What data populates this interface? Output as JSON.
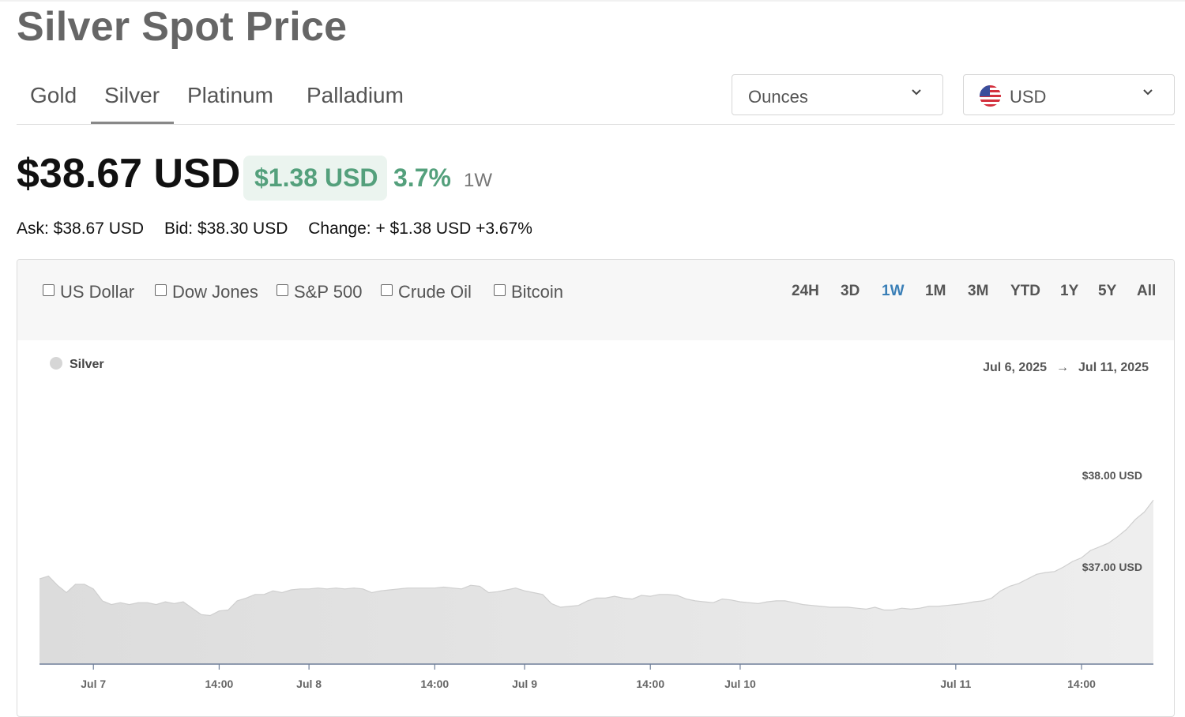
{
  "page_title": "Silver Spot Price",
  "tabs": [
    "Gold",
    "Silver",
    "Platinum",
    "Palladium"
  ],
  "active_tab": "Silver",
  "unit_select": {
    "value": "Ounces",
    "icon": "chevron-down-icon"
  },
  "currency_select": {
    "value": "USD",
    "icon": "us-flag-icon"
  },
  "price": {
    "value": "$38.67 USD",
    "change": "$1.38 USD",
    "change_pct": "3.7%",
    "period": "1W",
    "positive_color": "#54a07c"
  },
  "quotes": {
    "ask": "Ask: $38.67 USD",
    "bid": "Bid: $38.30 USD",
    "change": "Change: + $1.38 USD +3.67%"
  },
  "compare_options": [
    "US Dollar",
    "Dow Jones",
    "S&P 500",
    "Crude Oil",
    "Bitcoin"
  ],
  "ranges": [
    "24H",
    "3D",
    "1W",
    "1M",
    "3M",
    "YTD",
    "1Y",
    "5Y",
    "All"
  ],
  "active_range": "1W",
  "chart_data": {
    "type": "area",
    "date_range": {
      "from": "Jul 6, 2025",
      "arrow": "→",
      "to": "Jul 11, 2025"
    },
    "series": [
      {
        "name": "Silver",
        "color": "#d6d6d6",
        "points": [
          [
            "2025-07-06 18:00",
            36.87
          ],
          [
            "2025-07-06 19:00",
            36.9
          ],
          [
            "2025-07-06 20:00",
            36.8
          ],
          [
            "2025-07-06 21:00",
            36.72
          ],
          [
            "2025-07-06 22:00",
            36.81
          ],
          [
            "2025-07-06 23:00",
            36.81
          ],
          [
            "2025-07-07 00:00",
            36.76
          ],
          [
            "2025-07-07 01:00",
            36.63
          ],
          [
            "2025-07-07 02:00",
            36.59
          ],
          [
            "2025-07-07 03:00",
            36.61
          ],
          [
            "2025-07-07 04:00",
            36.59
          ],
          [
            "2025-07-07 05:00",
            36.61
          ],
          [
            "2025-07-07 06:00",
            36.61
          ],
          [
            "2025-07-07 07:00",
            36.59
          ],
          [
            "2025-07-07 08:00",
            36.62
          ],
          [
            "2025-07-07 09:00",
            36.6
          ],
          [
            "2025-07-07 10:00",
            36.62
          ],
          [
            "2025-07-07 11:00",
            36.55
          ],
          [
            "2025-07-07 12:00",
            36.48
          ],
          [
            "2025-07-07 13:00",
            36.47
          ],
          [
            "2025-07-07 14:00",
            36.52
          ],
          [
            "2025-07-07 15:00",
            36.53
          ],
          [
            "2025-07-07 16:00",
            36.63
          ],
          [
            "2025-07-07 17:00",
            36.66
          ],
          [
            "2025-07-07 18:00",
            36.7
          ],
          [
            "2025-07-07 19:00",
            36.7
          ],
          [
            "2025-07-07 20:00",
            36.74
          ],
          [
            "2025-07-07 21:00",
            36.72
          ],
          [
            "2025-07-07 22:00",
            36.75
          ],
          [
            "2025-07-07 23:00",
            36.76
          ],
          [
            "2025-07-08 00:00",
            36.76
          ],
          [
            "2025-07-08 01:00",
            36.77
          ],
          [
            "2025-07-08 02:00",
            36.76
          ],
          [
            "2025-07-08 03:00",
            36.77
          ],
          [
            "2025-07-08 04:00",
            36.76
          ],
          [
            "2025-07-08 05:00",
            36.77
          ],
          [
            "2025-07-08 06:00",
            36.76
          ],
          [
            "2025-07-08 07:00",
            36.72
          ],
          [
            "2025-07-08 08:00",
            36.74
          ],
          [
            "2025-07-08 09:00",
            36.75
          ],
          [
            "2025-07-08 10:00",
            36.76
          ],
          [
            "2025-07-08 11:00",
            36.77
          ],
          [
            "2025-07-08 12:00",
            36.77
          ],
          [
            "2025-07-08 13:00",
            36.77
          ],
          [
            "2025-07-08 14:00",
            36.77
          ],
          [
            "2025-07-08 15:00",
            36.78
          ],
          [
            "2025-07-08 16:00",
            36.77
          ],
          [
            "2025-07-08 17:00",
            36.76
          ],
          [
            "2025-07-08 18:00",
            36.8
          ],
          [
            "2025-07-08 19:00",
            36.79
          ],
          [
            "2025-07-08 20:00",
            36.72
          ],
          [
            "2025-07-08 21:00",
            36.73
          ],
          [
            "2025-07-08 22:00",
            36.75
          ],
          [
            "2025-07-08 23:00",
            36.77
          ],
          [
            "2025-07-09 00:00",
            36.74
          ],
          [
            "2025-07-09 01:00",
            36.72
          ],
          [
            "2025-07-09 02:00",
            36.7
          ],
          [
            "2025-07-09 03:00",
            36.6
          ],
          [
            "2025-07-09 04:00",
            36.56
          ],
          [
            "2025-07-09 05:00",
            36.57
          ],
          [
            "2025-07-09 06:00",
            36.58
          ],
          [
            "2025-07-09 07:00",
            36.63
          ],
          [
            "2025-07-09 08:00",
            36.66
          ],
          [
            "2025-07-09 09:00",
            36.66
          ],
          [
            "2025-07-09 10:00",
            36.68
          ],
          [
            "2025-07-09 11:00",
            36.66
          ],
          [
            "2025-07-09 12:00",
            36.65
          ],
          [
            "2025-07-09 13:00",
            36.69
          ],
          [
            "2025-07-09 14:00",
            36.68
          ],
          [
            "2025-07-09 15:00",
            36.7
          ],
          [
            "2025-07-09 16:00",
            36.7
          ],
          [
            "2025-07-09 17:00",
            36.69
          ],
          [
            "2025-07-09 18:00",
            36.65
          ],
          [
            "2025-07-09 19:00",
            36.63
          ],
          [
            "2025-07-09 20:00",
            36.62
          ],
          [
            "2025-07-09 21:00",
            36.61
          ],
          [
            "2025-07-09 22:00",
            36.65
          ],
          [
            "2025-07-09 23:00",
            36.64
          ],
          [
            "2025-07-10 00:00",
            36.62
          ],
          [
            "2025-07-10 01:00",
            36.61
          ],
          [
            "2025-07-10 02:00",
            36.6
          ],
          [
            "2025-07-10 03:00",
            36.62
          ],
          [
            "2025-07-10 04:00",
            36.63
          ],
          [
            "2025-07-10 05:00",
            36.63
          ],
          [
            "2025-07-10 06:00",
            36.61
          ],
          [
            "2025-07-10 07:00",
            36.59
          ],
          [
            "2025-07-10 08:00",
            36.58
          ],
          [
            "2025-07-10 09:00",
            36.57
          ],
          [
            "2025-07-10 10:00",
            36.56
          ],
          [
            "2025-07-10 11:00",
            36.56
          ],
          [
            "2025-07-10 12:00",
            36.56
          ],
          [
            "2025-07-10 13:00",
            36.55
          ],
          [
            "2025-07-10 14:00",
            36.54
          ],
          [
            "2025-07-10 15:00",
            36.56
          ],
          [
            "2025-07-10 16:00",
            36.53
          ],
          [
            "2025-07-10 17:00",
            36.53
          ],
          [
            "2025-07-10 18:00",
            36.55
          ],
          [
            "2025-07-10 19:00",
            36.54
          ],
          [
            "2025-07-10 20:00",
            36.55
          ],
          [
            "2025-07-10 21:00",
            36.57
          ],
          [
            "2025-07-10 22:00",
            36.57
          ],
          [
            "2025-07-10 23:00",
            36.58
          ],
          [
            "2025-07-11 00:00",
            36.59
          ],
          [
            "2025-07-11 01:00",
            36.6
          ],
          [
            "2025-07-11 02:00",
            36.62
          ],
          [
            "2025-07-11 03:00",
            36.63
          ],
          [
            "2025-07-11 04:00",
            36.66
          ],
          [
            "2025-07-11 05:00",
            36.74
          ],
          [
            "2025-07-11 06:00",
            36.79
          ],
          [
            "2025-07-11 07:00",
            36.82
          ],
          [
            "2025-07-11 08:00",
            36.87
          ],
          [
            "2025-07-11 09:00",
            36.92
          ],
          [
            "2025-07-11 10:00",
            36.94
          ],
          [
            "2025-07-11 11:00",
            36.95
          ],
          [
            "2025-07-11 12:00",
            37.0
          ],
          [
            "2025-07-11 13:00",
            37.06
          ],
          [
            "2025-07-11 14:00",
            37.1
          ],
          [
            "2025-07-11 15:00",
            37.18
          ],
          [
            "2025-07-11 16:00",
            37.22
          ],
          [
            "2025-07-11 17:00",
            37.26
          ],
          [
            "2025-07-11 18:00",
            37.33
          ],
          [
            "2025-07-11 19:00",
            37.41
          ],
          [
            "2025-07-11 20:00",
            37.52
          ],
          [
            "2025-07-11 21:00",
            37.6
          ],
          [
            "2025-07-11 22:00",
            37.73
          ]
        ]
      }
    ],
    "y_ticks": [
      {
        "value": 37.0,
        "label": "$37.00 USD"
      },
      {
        "value": 38.0,
        "label": "$38.00 USD"
      }
    ],
    "x_ticks": [
      {
        "t": "2025-07-07 00:00",
        "label": "Jul 7"
      },
      {
        "t": "2025-07-07 14:00",
        "label": "14:00"
      },
      {
        "t": "2025-07-08 00:00",
        "label": "Jul 8"
      },
      {
        "t": "2025-07-08 14:00",
        "label": "14:00"
      },
      {
        "t": "2025-07-09 00:00",
        "label": "Jul 9"
      },
      {
        "t": "2025-07-09 14:00",
        "label": "14:00"
      },
      {
        "t": "2025-07-10 00:00",
        "label": "Jul 10"
      },
      {
        "t": "2025-07-11 00:00",
        "label": "Jul 11"
      },
      {
        "t": "2025-07-11 14:00",
        "label": "14:00"
      }
    ],
    "grid": false,
    "legend_position": "top-left"
  }
}
